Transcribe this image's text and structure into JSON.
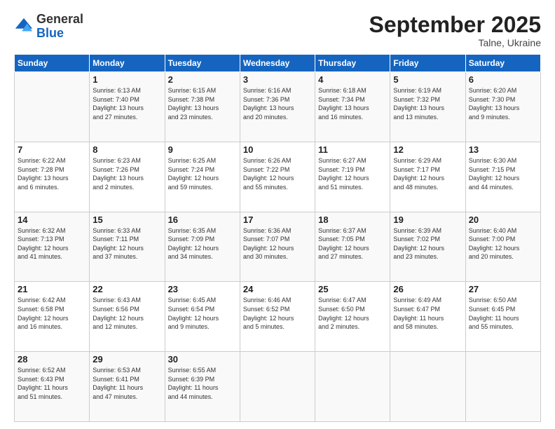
{
  "logo": {
    "general": "General",
    "blue": "Blue"
  },
  "header": {
    "month": "September 2025",
    "location": "Talne, Ukraine"
  },
  "weekdays": [
    "Sunday",
    "Monday",
    "Tuesday",
    "Wednesday",
    "Thursday",
    "Friday",
    "Saturday"
  ],
  "weeks": [
    [
      {
        "day": "",
        "info": ""
      },
      {
        "day": "1",
        "info": "Sunrise: 6:13 AM\nSunset: 7:40 PM\nDaylight: 13 hours\nand 27 minutes."
      },
      {
        "day": "2",
        "info": "Sunrise: 6:15 AM\nSunset: 7:38 PM\nDaylight: 13 hours\nand 23 minutes."
      },
      {
        "day": "3",
        "info": "Sunrise: 6:16 AM\nSunset: 7:36 PM\nDaylight: 13 hours\nand 20 minutes."
      },
      {
        "day": "4",
        "info": "Sunrise: 6:18 AM\nSunset: 7:34 PM\nDaylight: 13 hours\nand 16 minutes."
      },
      {
        "day": "5",
        "info": "Sunrise: 6:19 AM\nSunset: 7:32 PM\nDaylight: 13 hours\nand 13 minutes."
      },
      {
        "day": "6",
        "info": "Sunrise: 6:20 AM\nSunset: 7:30 PM\nDaylight: 13 hours\nand 9 minutes."
      }
    ],
    [
      {
        "day": "7",
        "info": "Sunrise: 6:22 AM\nSunset: 7:28 PM\nDaylight: 13 hours\nand 6 minutes."
      },
      {
        "day": "8",
        "info": "Sunrise: 6:23 AM\nSunset: 7:26 PM\nDaylight: 13 hours\nand 2 minutes."
      },
      {
        "day": "9",
        "info": "Sunrise: 6:25 AM\nSunset: 7:24 PM\nDaylight: 12 hours\nand 59 minutes."
      },
      {
        "day": "10",
        "info": "Sunrise: 6:26 AM\nSunset: 7:22 PM\nDaylight: 12 hours\nand 55 minutes."
      },
      {
        "day": "11",
        "info": "Sunrise: 6:27 AM\nSunset: 7:19 PM\nDaylight: 12 hours\nand 51 minutes."
      },
      {
        "day": "12",
        "info": "Sunrise: 6:29 AM\nSunset: 7:17 PM\nDaylight: 12 hours\nand 48 minutes."
      },
      {
        "day": "13",
        "info": "Sunrise: 6:30 AM\nSunset: 7:15 PM\nDaylight: 12 hours\nand 44 minutes."
      }
    ],
    [
      {
        "day": "14",
        "info": "Sunrise: 6:32 AM\nSunset: 7:13 PM\nDaylight: 12 hours\nand 41 minutes."
      },
      {
        "day": "15",
        "info": "Sunrise: 6:33 AM\nSunset: 7:11 PM\nDaylight: 12 hours\nand 37 minutes."
      },
      {
        "day": "16",
        "info": "Sunrise: 6:35 AM\nSunset: 7:09 PM\nDaylight: 12 hours\nand 34 minutes."
      },
      {
        "day": "17",
        "info": "Sunrise: 6:36 AM\nSunset: 7:07 PM\nDaylight: 12 hours\nand 30 minutes."
      },
      {
        "day": "18",
        "info": "Sunrise: 6:37 AM\nSunset: 7:05 PM\nDaylight: 12 hours\nand 27 minutes."
      },
      {
        "day": "19",
        "info": "Sunrise: 6:39 AM\nSunset: 7:02 PM\nDaylight: 12 hours\nand 23 minutes."
      },
      {
        "day": "20",
        "info": "Sunrise: 6:40 AM\nSunset: 7:00 PM\nDaylight: 12 hours\nand 20 minutes."
      }
    ],
    [
      {
        "day": "21",
        "info": "Sunrise: 6:42 AM\nSunset: 6:58 PM\nDaylight: 12 hours\nand 16 minutes."
      },
      {
        "day": "22",
        "info": "Sunrise: 6:43 AM\nSunset: 6:56 PM\nDaylight: 12 hours\nand 12 minutes."
      },
      {
        "day": "23",
        "info": "Sunrise: 6:45 AM\nSunset: 6:54 PM\nDaylight: 12 hours\nand 9 minutes."
      },
      {
        "day": "24",
        "info": "Sunrise: 6:46 AM\nSunset: 6:52 PM\nDaylight: 12 hours\nand 5 minutes."
      },
      {
        "day": "25",
        "info": "Sunrise: 6:47 AM\nSunset: 6:50 PM\nDaylight: 12 hours\nand 2 minutes."
      },
      {
        "day": "26",
        "info": "Sunrise: 6:49 AM\nSunset: 6:47 PM\nDaylight: 11 hours\nand 58 minutes."
      },
      {
        "day": "27",
        "info": "Sunrise: 6:50 AM\nSunset: 6:45 PM\nDaylight: 11 hours\nand 55 minutes."
      }
    ],
    [
      {
        "day": "28",
        "info": "Sunrise: 6:52 AM\nSunset: 6:43 PM\nDaylight: 11 hours\nand 51 minutes."
      },
      {
        "day": "29",
        "info": "Sunrise: 6:53 AM\nSunset: 6:41 PM\nDaylight: 11 hours\nand 47 minutes."
      },
      {
        "day": "30",
        "info": "Sunrise: 6:55 AM\nSunset: 6:39 PM\nDaylight: 11 hours\nand 44 minutes."
      },
      {
        "day": "",
        "info": ""
      },
      {
        "day": "",
        "info": ""
      },
      {
        "day": "",
        "info": ""
      },
      {
        "day": "",
        "info": ""
      }
    ]
  ]
}
